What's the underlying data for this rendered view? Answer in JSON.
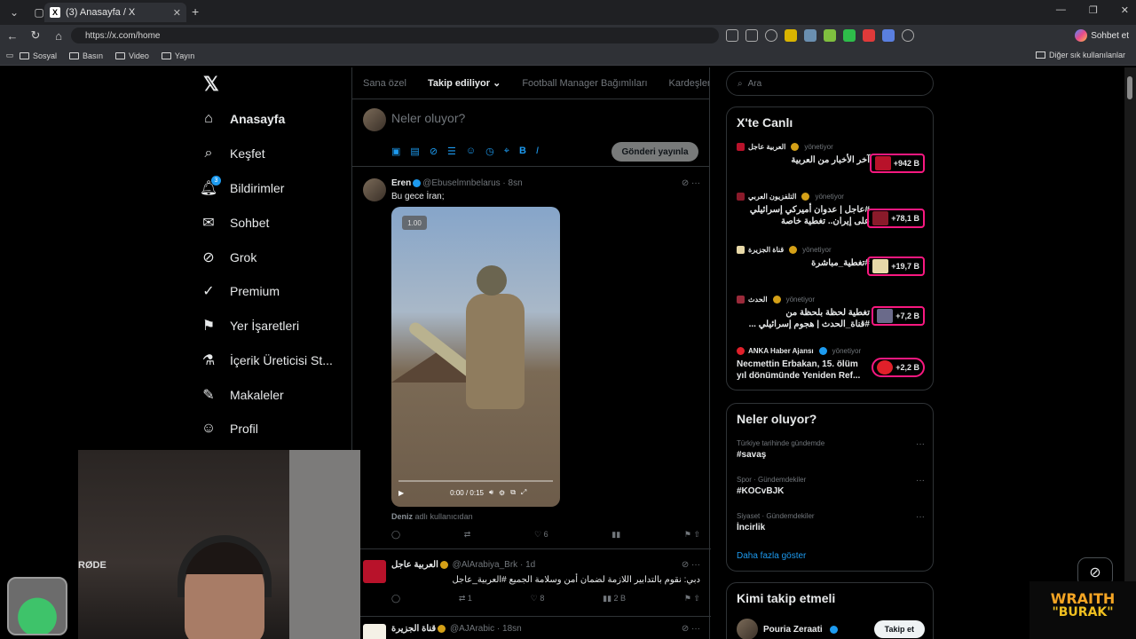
{
  "browser": {
    "tab_title": "(3) Anasayfa / X",
    "url": "https://x.com/home",
    "chat_button": "Sohbet et",
    "bookmarks": [
      "Sosyal",
      "Basın",
      "Video",
      "Yayın"
    ],
    "other_favorites": "Diğer sık kullanılanlar"
  },
  "nav": {
    "items": [
      {
        "label": "Anasayfa",
        "icon": "home-icon"
      },
      {
        "label": "Keşfet",
        "icon": "search-icon"
      },
      {
        "label": "Bildirimler",
        "icon": "bell-icon",
        "badge": "3"
      },
      {
        "label": "Sohbet",
        "icon": "mail-icon"
      },
      {
        "label": "Grok",
        "icon": "grok-icon"
      },
      {
        "label": "Premium",
        "icon": "premium-icon"
      },
      {
        "label": "Yer İşaretleri",
        "icon": "bookmark-icon"
      },
      {
        "label": "İçerik Üreticisi St...",
        "icon": "flask-icon"
      },
      {
        "label": "Makaleler",
        "icon": "article-icon"
      },
      {
        "label": "Profil",
        "icon": "person-icon"
      }
    ]
  },
  "feed": {
    "tabs": [
      "Sana özel",
      "Takip ediliyor",
      "Football Manager Bağımlıları",
      "Kardeşler Kıra"
    ],
    "composer_placeholder": "Neler oluyor?",
    "post_button": "Gönderi yayınla",
    "tweets": [
      {
        "name": "Eren",
        "handle": "@Ebuselmnbelarus · 8sn",
        "text": "Bu gece İran;",
        "video_speed": "1.00",
        "video_time": "0:00 / 0:15",
        "footer_name": "Deniz",
        "footer_text": "adlı kullanıcıdan",
        "likes": "6"
      },
      {
        "name": "العربية عاجل",
        "handle": "@AlArabiya_Brk · 1d",
        "text": "دبي: نقوم بالتدابير اللازمة لضمان أمن وسلامة الجميع #العربية_عاجل",
        "retweets": "1",
        "likes": "8",
        "views": "2 B"
      },
      {
        "name": "قناة الجزيرة",
        "handle": "@AJArabic · 18sn"
      }
    ]
  },
  "sidebar": {
    "search_placeholder": "Ara",
    "live_title": "X'te Canlı",
    "live": [
      {
        "source": "العربية عاجل",
        "status": "yönetiyor",
        "text": "آخر الأخبار من العربية",
        "count": "+942 B"
      },
      {
        "source": "التلفزيون العربي",
        "status": "yönetiyor",
        "text": "#عاجل | عدوان أميركي إسرائيلي على إيران.. تغطية خاصة",
        "count": "+78,1 B"
      },
      {
        "source": "قناة الجزيرة",
        "status": "yönetiyor",
        "text": "#تغطية_مباشرة",
        "count": "+19,7 B"
      },
      {
        "source": "الحدث",
        "status": "yönetiyor",
        "text": "تغطية لحظة بلحظة من #قناة_الحدث | هجوم إسرائيلي ...",
        "count": "+7,2 B"
      },
      {
        "source": "ANKA Haber Ajansı",
        "status": "yönetiyor",
        "text": "Necmettin Erbakan, 15. ölüm yıl dönümünde Yeniden Ref...",
        "count": "+2,2 B"
      }
    ],
    "trends_title": "Neler oluyor?",
    "trends": [
      {
        "meta": "Türkiye tarihinde gündemde",
        "name": "#savaş"
      },
      {
        "meta": "Spor · Gündemdekiler",
        "name": "#KOCvBJK"
      },
      {
        "meta": "Siyaset · Gündemdekiler",
        "name": "İncirlik"
      }
    ],
    "show_more": "Daha fazla göster",
    "follow_title": "Kimi takip etmeli",
    "follow": {
      "name": "Pouria Zeraati",
      "button": "Takip et"
    }
  },
  "overlay": {
    "mic_brand": "RØDE",
    "streamer_line1": "WRAITH",
    "streamer_line2": "\"BURAK\""
  }
}
